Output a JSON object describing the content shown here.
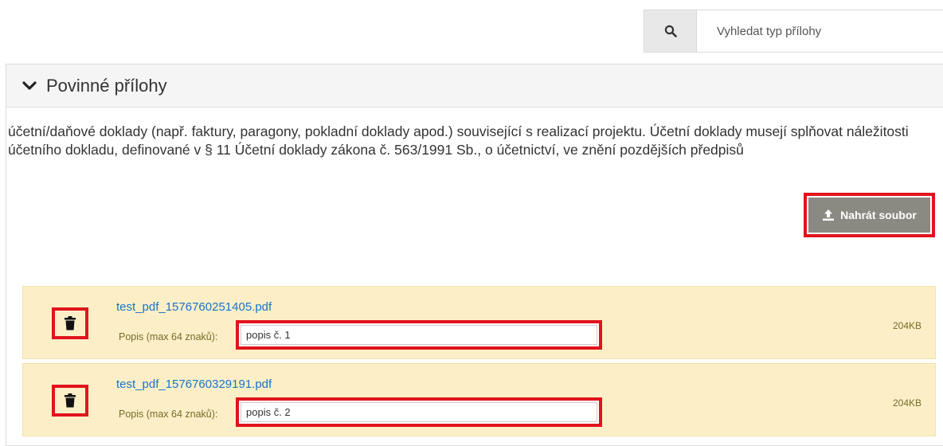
{
  "search": {
    "placeholder": "Vyhledat typ přílohy",
    "icon": "search-icon"
  },
  "panel": {
    "title": "Povinné přílohy",
    "icon": "chevron-down-icon",
    "description": "účetní/daňové doklady (např. faktury, paragony, pokladní doklady apod.) související s realizací projektu. Účetní doklady musejí splňovat náležitosti účetního dokladu, definované v § 11 Účetní doklady zákona č. 563/1991 Sb., o účetnictví, ve znění pozdějších předpisů",
    "upload_label": "Nahrát soubor",
    "upload_icon": "upload-icon"
  },
  "files": [
    {
      "name": "test_pdf_1576760251405.pdf",
      "desc_label": "Popis (max 64 znaků):",
      "desc_value": "popis č. 1",
      "size": "204KB"
    },
    {
      "name": "test_pdf_1576760329191.pdf",
      "desc_label": "Popis (max 64 znaků):",
      "desc_value": "popis č. 2",
      "size": "204KB"
    }
  ],
  "colors": {
    "highlight": "#e0141d",
    "file_row_bg": "#fcefc7",
    "upload_btn_bg": "#8a8a82",
    "link": "#1a73c9"
  }
}
